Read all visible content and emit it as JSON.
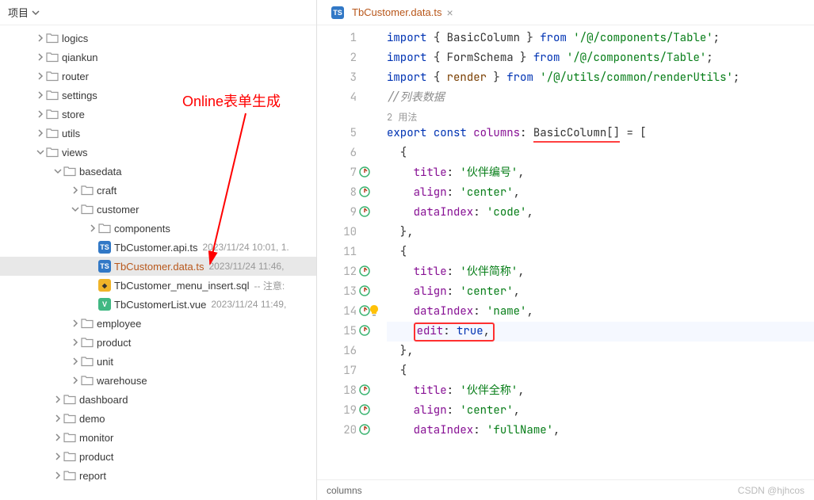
{
  "sidebar": {
    "title": "项目",
    "tree": {
      "logics": "logics",
      "qiankun": "qiankun",
      "router": "router",
      "settings": "settings",
      "store": "store",
      "utils": "utils",
      "views": "views",
      "basedata": "basedata",
      "craft": "craft",
      "customer": "customer",
      "components": "components",
      "files": {
        "api": {
          "name": "TbCustomer.api.ts",
          "meta": "2023/11/24 10:01, 1."
        },
        "data": {
          "name": "TbCustomer.data.ts",
          "meta": "2023/11/24 11:46,"
        },
        "sql": {
          "name": "TbCustomer_menu_insert.sql",
          "meta": "-- 注意:"
        },
        "vue": {
          "name": "TbCustomerList.vue",
          "meta": "2023/11/24 11:49,"
        }
      },
      "employee": "employee",
      "product": "product",
      "unit": "unit",
      "warehouse": "warehouse",
      "dashboard": "dashboard",
      "demo": "demo",
      "monitor": "monitor",
      "product2": "product",
      "report": "report"
    },
    "annotation": "Online表单生成"
  },
  "tab": {
    "title": "TbCustomer.data.ts"
  },
  "code": {
    "usages": "2 用法",
    "l1": {
      "import": "import",
      "lb": "{ ",
      "name": "BasicColumn",
      "rb": " }",
      "from": "from",
      "path": "'/@/components/Table'",
      "semi": ";"
    },
    "l2": {
      "import": "import",
      "lb": "{ ",
      "name": "FormSchema",
      "rb": " }",
      "from": "from",
      "path": "'/@/components/Table'",
      "semi": ";"
    },
    "l3": {
      "import": "import",
      "lb": "{ ",
      "name": "render",
      "rb": " }",
      "from": "from",
      "path": "'/@/utils/common/renderUtils'",
      "semi": ";"
    },
    "l4": "//列表数据",
    "l5": {
      "export": "export",
      "const": "const",
      "name": "columns",
      "colon": ": ",
      "type": "BasicColumn[]",
      "eq": " = ["
    },
    "l6": "  {",
    "l7": {
      "key": "title",
      "sep": ": ",
      "val": "'伙伴编号'",
      "comma": ","
    },
    "l8": {
      "key": "align",
      "sep": ": ",
      "val": "'center'",
      "comma": ","
    },
    "l9": {
      "key": "dataIndex",
      "sep": ": ",
      "val": "'code'",
      "comma": ","
    },
    "l10": "  },",
    "l11": "  {",
    "l12": {
      "key": "title",
      "sep": ": ",
      "val": "'伙伴简称'",
      "comma": ","
    },
    "l13": {
      "key": "align",
      "sep": ": ",
      "val": "'center'",
      "comma": ","
    },
    "l14": {
      "key": "dataIndex",
      "sep": ": ",
      "val": "'name'",
      "comma": ","
    },
    "l15": {
      "key": "edit",
      "sep": ": ",
      "val": "true",
      "comma": ","
    },
    "l16": "  },",
    "l17": "  {",
    "l18": {
      "key": "title",
      "sep": ": ",
      "val": "'伙伴全称'",
      "comma": ","
    },
    "l19": {
      "key": "align",
      "sep": ": ",
      "val": "'center'",
      "comma": ","
    },
    "l20": {
      "key": "dataIndex",
      "sep": ": ",
      "val": "'fullName'",
      "comma": ","
    }
  },
  "breadcrumb": "columns",
  "watermark": "CSDN @hjhcos"
}
